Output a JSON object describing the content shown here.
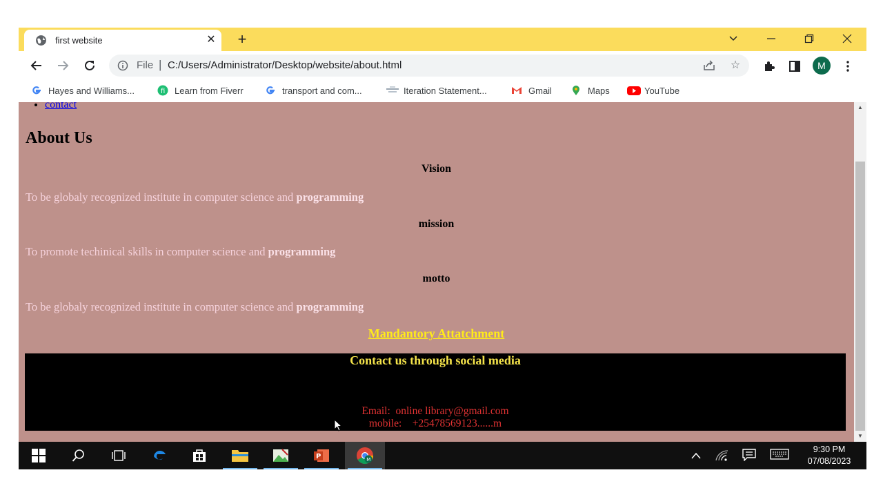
{
  "browser": {
    "tab_title": "first website",
    "new_tab_label": "+",
    "omnibox": {
      "file_label": "File",
      "separator": "|",
      "url": "C:/Users/Administrator/Desktop/website/about.html"
    },
    "avatar_letter": "M"
  },
  "bookmarks": [
    {
      "label": "Hayes and Williams...",
      "icon": "google-icon"
    },
    {
      "label": "Learn from Fiverr",
      "icon": "fiverr-icon"
    },
    {
      "label": "transport and com...",
      "icon": "google-icon"
    },
    {
      "label": "Iteration Statement...",
      "icon": "page-icon"
    },
    {
      "label": "Gmail",
      "icon": "gmail-icon"
    },
    {
      "label": "Maps",
      "icon": "maps-icon"
    },
    {
      "label": "YouTube",
      "icon": "youtube-icon"
    }
  ],
  "page": {
    "nav_link": "contact",
    "heading": "About Us",
    "sections": [
      {
        "title": "Vision",
        "text": "To be globaly recognized institute in computer science and ",
        "bold": "programming"
      },
      {
        "title": "mission",
        "text": "To promote techinical skills in computer science and ",
        "bold": "programming"
      },
      {
        "title": "motto",
        "text": "To be globaly recognized institute in computer science and ",
        "bold": "programming"
      }
    ],
    "attachment_link": "Mandantory Attatchment",
    "footer": {
      "heading": "Contact us through social media",
      "email_line": "Email:  online library@gmail.com",
      "mobile_line": "mobile:    +25478569123......m"
    },
    "colors": {
      "background": "#be918b",
      "footer_background": "#000000",
      "accent_yellow": "#f4e34a",
      "contact_red": "#e23333"
    }
  },
  "taskbar": {
    "time": "9:30 PM",
    "date": "07/08/2023",
    "apps": [
      "windows-start-icon",
      "search-icon",
      "task-view-icon",
      "edge-icon",
      "store-icon",
      "file-explorer-icon",
      "photo-app-icon",
      "powerpoint-icon",
      "chrome-icon"
    ]
  }
}
